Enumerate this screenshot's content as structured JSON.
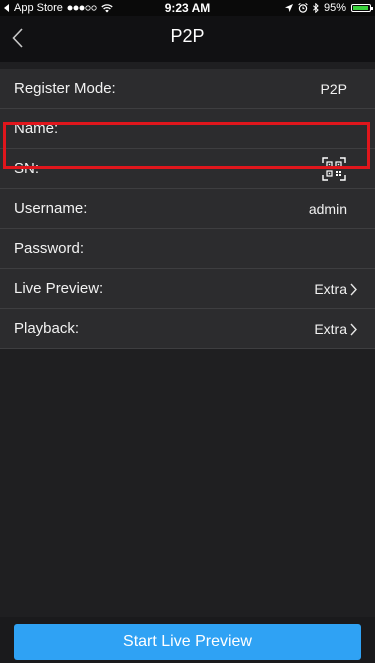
{
  "status_bar": {
    "carrier": "App Store",
    "time": "9:23 AM",
    "battery_percent": "95%",
    "battery_level": 0.95
  },
  "nav": {
    "title": "P2P"
  },
  "form": {
    "register_mode": {
      "label": "Register Mode:",
      "value": "P2P"
    },
    "name": {
      "label": "Name:",
      "value": ""
    },
    "sn": {
      "label": "SN:",
      "value": ""
    },
    "username": {
      "label": "Username:",
      "value": "admin"
    },
    "password": {
      "label": "Password:",
      "value": ""
    },
    "live_preview": {
      "label": "Live Preview:",
      "value": "Extra"
    },
    "playback": {
      "label": "Playback:",
      "value": "Extra"
    }
  },
  "bottom": {
    "start_button_label": "Start Live Preview"
  },
  "colors": {
    "highlight": "#e0161c",
    "accent": "#2fa2f4",
    "battery": "#3ad13c"
  }
}
